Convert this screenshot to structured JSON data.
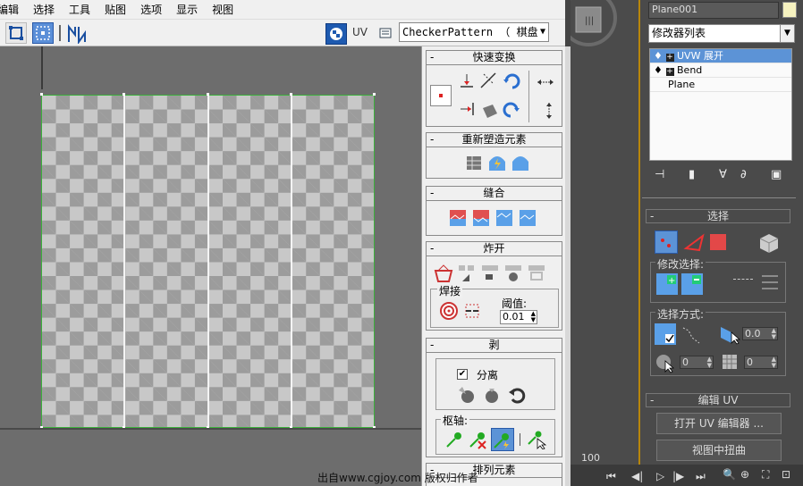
{
  "menu": [
    "编辑",
    "选择",
    "工具",
    "贴图",
    "选项",
    "显示",
    "视图"
  ],
  "toolbar": {
    "uv_label": "UV",
    "texture_select": "CheckerPattern （ 棋盘"
  },
  "rollouts": {
    "quick_transform": {
      "title": "快速变换"
    },
    "reshape": {
      "title": "重新塑造元素"
    },
    "stitch": {
      "title": "缝合"
    },
    "explode": {
      "title": "炸开",
      "weld_label": "焊接",
      "threshold_label": "阈值:",
      "threshold_value": "0.01"
    },
    "peel": {
      "title": "剥",
      "detach_label": "分离",
      "detach_checked": true,
      "pivot_label": "枢轴:"
    },
    "arrange": {
      "title": "排列元素"
    }
  },
  "command_panel": {
    "object_name": "Plane001",
    "modifier_list": "修改器列表",
    "stack": [
      {
        "label": "UVW 展开",
        "selected": true
      },
      {
        "label": "Bend",
        "selected": false
      },
      {
        "label": "Plane",
        "selected": false
      }
    ],
    "selection": {
      "title": "选择",
      "modify_label": "修改选择:",
      "method_label": "选择方式:",
      "angle_value": "0.0",
      "spin2_value": "0",
      "spin3_value": "0"
    },
    "edit_uv": {
      "title": "编辑 UV",
      "open_editor": "打开 UV 编辑器 ...",
      "tweak_in_view": "视图中扭曲"
    }
  },
  "timeline": {
    "frame": "100"
  },
  "watermark": "出自www.cgjoy.com 版权归作者",
  "colors": {
    "selection_blue": "#5c93d6",
    "seam_green": "#3bb03b",
    "max_dark": "#4a4a4a"
  }
}
